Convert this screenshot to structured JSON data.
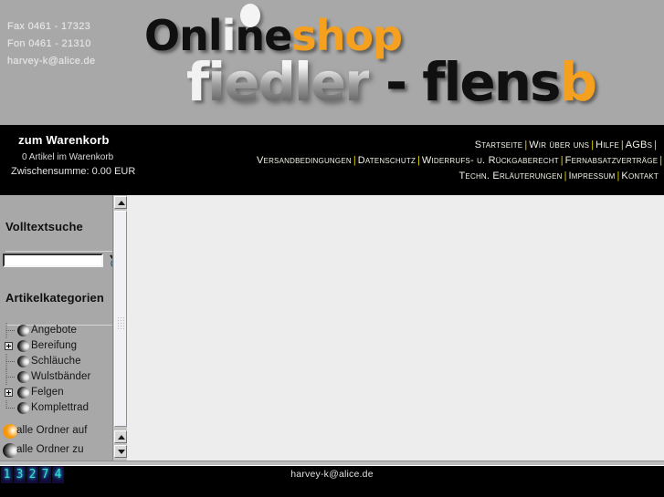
{
  "header": {
    "contact": {
      "fax": "Fax 0461 - 17323",
      "fon": "Fon 0461 - 21310",
      "email": "harvey-k@alice.de"
    },
    "logo": {
      "line1_part1": "Onl",
      "line1_dot_letter": "i",
      "line1_part2": "ne",
      "line1_part3": "shop",
      "line2_part1": "f",
      "line2_part2": "iedler",
      "line2_part3": " - flens",
      "line2_part4": "b",
      "colors": {
        "black": "#101010",
        "white": "#f2f2f2",
        "orange": "#f5a01e",
        "banner_bg": "#a8a8a8"
      }
    }
  },
  "cart": {
    "title": "zum Warenkorb",
    "count_text": "0 Artikel im Warenkorb",
    "subtotal_text": "Zwischensumme: 0.00 EUR"
  },
  "nav": {
    "separator": "|",
    "rows": [
      [
        "Startseite",
        "Wir über uns",
        "Hilfe",
        "AGBs"
      ],
      [
        "Versandbedingungen",
        "Datenschutz",
        "Widerrufs- u. Rückgaberecht",
        "Fernabsatzverträge"
      ],
      [
        "Techn. Erläuterungen",
        "Impressum",
        "Kontakt"
      ]
    ],
    "row1": {
      "item0": "Startseite",
      "item1": "Wir über uns",
      "item2": "Hilfe",
      "item3": "AGBs"
    },
    "row2": {
      "item0": "Versandbedingungen",
      "item1": "Datenschutz",
      "item2": "Widerrufs- u. Rückgaberecht",
      "item3": "Fernabsatzverträge"
    },
    "row3": {
      "item0": "Techn. Erläuterungen",
      "item1": "Impressum",
      "item2": "Kontakt"
    },
    "separator_color": "#e8d300",
    "link_color": "#f3f3e8"
  },
  "sidebar": {
    "search_heading": "Volltextsuche",
    "search_value": "",
    "search_placeholder": "",
    "search_icon": "magnifier-icon",
    "categories_heading": "Artikelkategorien",
    "tree_items": [
      {
        "label": "Angebote",
        "expandable": false
      },
      {
        "label": "Bereifung",
        "expandable": true
      },
      {
        "label": "Schläuche",
        "expandable": false
      },
      {
        "label": "Wulstbänder",
        "expandable": false
      },
      {
        "label": "Felgen",
        "expandable": true
      },
      {
        "label": "Komplettrad",
        "expandable": false
      }
    ],
    "tree_items_flat": {
      "i0": "Angebote",
      "i1": "Bereifung",
      "i2": "Schläuche",
      "i3": "Wulstbänder",
      "i4": "Felgen",
      "i5": "Komplettrad"
    },
    "actions": {
      "expand_all": "alle Ordner auf",
      "collapse_all": "alle Ordner zu"
    }
  },
  "footer": {
    "email": "harvey-k@alice.de",
    "counter_digits": [
      "1",
      "3",
      "2",
      "7",
      "4"
    ],
    "counter": {
      "d0": "1",
      "d1": "3",
      "d2": "2",
      "d3": "7",
      "d4": "4"
    }
  }
}
